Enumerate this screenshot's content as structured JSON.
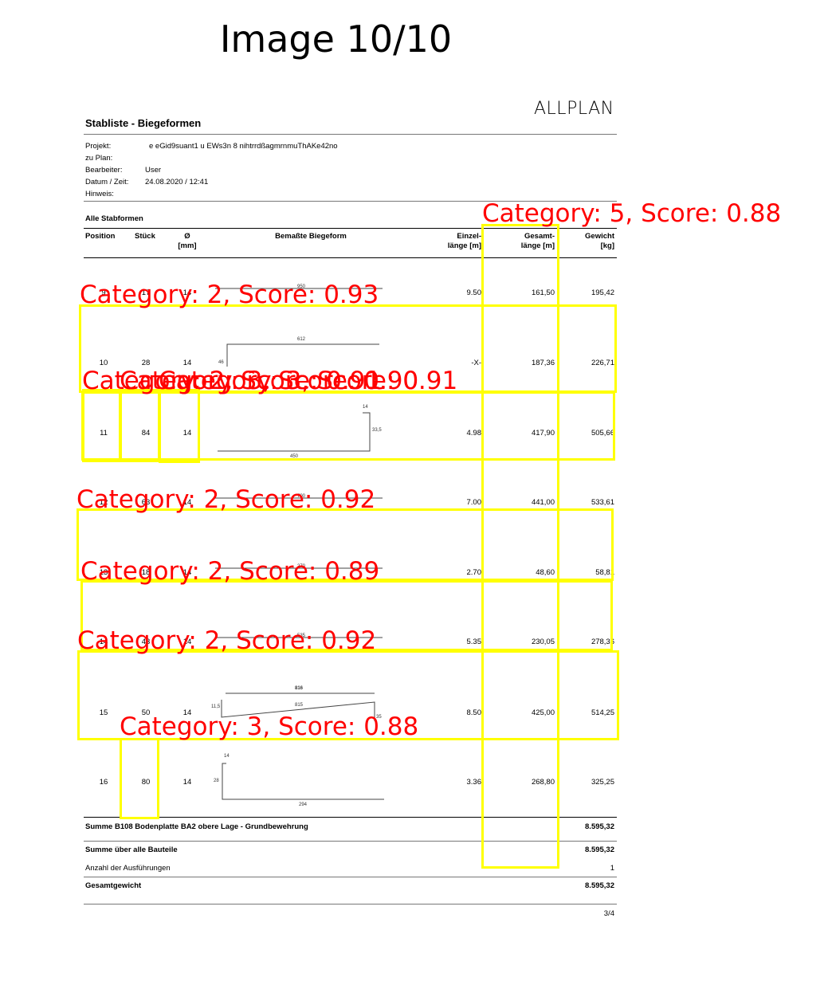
{
  "figure_title": "Image 10/10",
  "logo_text": "ALLPLAN",
  "document": {
    "title": "Stabliste - Biegeformen",
    "meta": [
      {
        "label": "Projekt:",
        "value": "e eGid9suant1 u EWs3n 8 nihtrrdßagmrnmuThAKe42no"
      },
      {
        "label": "zu Plan:",
        "value": ""
      },
      {
        "label": "Bearbeiter:",
        "value": "User"
      },
      {
        "label": "Datum / Zeit:",
        "value": "24.08.2020  /  12:41"
      },
      {
        "label": "Hinweis:",
        "value": ""
      }
    ],
    "section_title": "Alle Stabformen",
    "headers": {
      "position": "Position",
      "stueck": "Stück",
      "durchmesser_1": "Ø",
      "durchmesser_2": "[mm]",
      "biegeform": "Bemaßte Biegeform",
      "einzel_1": "Einzel-",
      "einzel_2": "länge [m]",
      "gesamt_1": "Gesamt-",
      "gesamt_2": "länge [m]",
      "gewicht_1": "Gewicht",
      "gewicht_2": "[kg]"
    },
    "rows": [
      {
        "position": "9",
        "stueck": "17",
        "durchmesser": "14",
        "einzel": "9.50",
        "gesamt": "161,50",
        "gewicht": "195,42",
        "dims": [
          "950"
        ]
      },
      {
        "position": "10",
        "stueck": "28",
        "durchmesser": "14",
        "einzel": "-X-",
        "gesamt": "187,36",
        "gewicht": "226,71",
        "dims": [
          "612",
          "46"
        ]
      },
      {
        "position": "11",
        "stueck": "84",
        "durchmesser": "14",
        "einzel": "4.98",
        "gesamt": "417,90",
        "gewicht": "505,66",
        "dims": [
          "14",
          "33,5",
          "450"
        ]
      },
      {
        "position": "12",
        "stueck": "63",
        "durchmesser": "14",
        "einzel": "7.00",
        "gesamt": "441,00",
        "gewicht": "533,61",
        "dims": [
          "700"
        ]
      },
      {
        "position": "13",
        "stueck": "18",
        "durchmesser": "14",
        "einzel": "2.70",
        "gesamt": "48,60",
        "gewicht": "58,81",
        "dims": [
          "270"
        ]
      },
      {
        "position": "14",
        "stueck": "43",
        "durchmesser": "14",
        "einzel": "5.35",
        "gesamt": "230,05",
        "gewicht": "278,36",
        "dims": [
          "535"
        ]
      },
      {
        "position": "15",
        "stueck": "50",
        "durchmesser": "14",
        "einzel": "8.50",
        "gesamt": "425,00",
        "gewicht": "514,25",
        "dims": [
          "816",
          "815",
          "11,5",
          "35"
        ]
      },
      {
        "position": "16",
        "stueck": "80",
        "durchmesser": "14",
        "einzel": "3.36",
        "gesamt": "268,80",
        "gewicht": "325,25",
        "dims": [
          "14",
          "28",
          "294"
        ]
      }
    ],
    "summary": [
      {
        "label": "Summe B108 Bodenplatte BA2  obere Lage - Grundbewehrung",
        "value": "8.595,32"
      },
      {
        "label": "Summe über alle Bauteile",
        "value": "8.595,32"
      },
      {
        "label": "Anzahl der Ausführungen",
        "value": "1"
      },
      {
        "label": "Gesamtgewicht",
        "value": "8.595,32"
      }
    ],
    "page_number": "3/4"
  },
  "detections": [
    {
      "label": "Category: 5, Score: 0.88"
    },
    {
      "label": "Category: 2, Score: 0.93"
    },
    {
      "label": "Category: 2, Score: 0.91"
    },
    {
      "label": "Category: 3, Score: 0.90"
    },
    {
      "label": "Category: 3, Score: 0.91"
    },
    {
      "label": "Category: 2, Score: 0.92"
    },
    {
      "label": "Category: 2, Score: 0.89"
    },
    {
      "label": "Category: 2, Score: 0.92"
    },
    {
      "label": "Category: 3, Score: 0.88"
    }
  ],
  "colors": {
    "box": "#ffff00",
    "label": "#ff0000"
  }
}
